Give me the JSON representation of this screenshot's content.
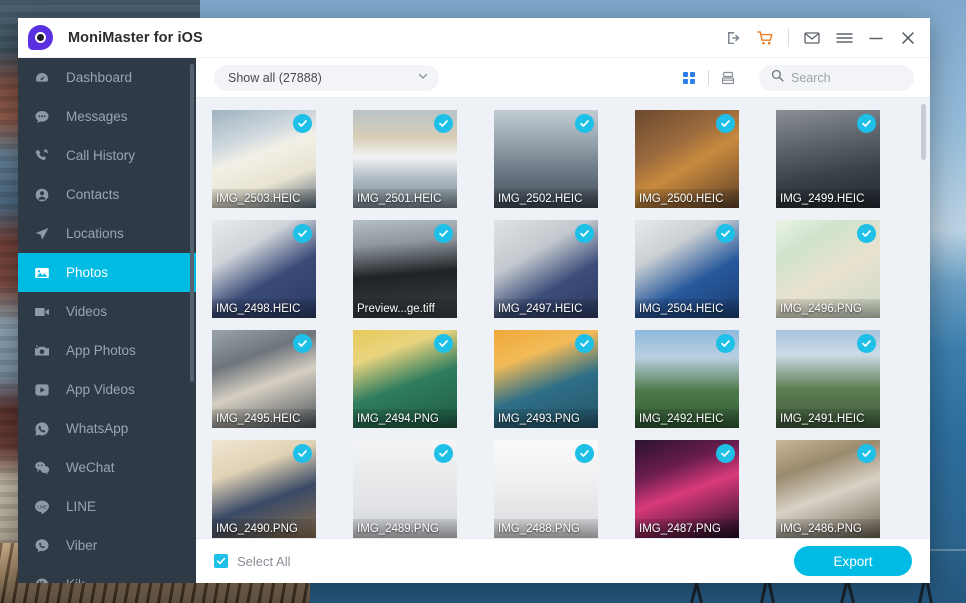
{
  "window": {
    "app_title": "MoniMaster for iOS",
    "logo_color": "#5b30e0",
    "accent_color": "#00bce4",
    "titlebar_icons": [
      {
        "name": "export-device-icon",
        "label": "Export"
      },
      {
        "name": "shopping-cart-icon",
        "label": "Store"
      },
      {
        "name": "mail-icon",
        "label": "Mail"
      },
      {
        "name": "menu-icon",
        "label": "Menu"
      },
      {
        "name": "minimize-icon",
        "label": "Minimize"
      },
      {
        "name": "close-icon",
        "label": "Close"
      }
    ]
  },
  "sidebar": {
    "items": [
      {
        "label": "Dashboard",
        "icon": "dashboard-icon",
        "active": false
      },
      {
        "label": "Messages",
        "icon": "messages-icon",
        "active": false
      },
      {
        "label": "Call History",
        "icon": "call-history-icon",
        "active": false
      },
      {
        "label": "Contacts",
        "icon": "contacts-icon",
        "active": false
      },
      {
        "label": "Locations",
        "icon": "locations-icon",
        "active": false
      },
      {
        "label": "Photos",
        "icon": "photos-icon",
        "active": true
      },
      {
        "label": "Videos",
        "icon": "videos-icon",
        "active": false
      },
      {
        "label": "App Photos",
        "icon": "app-photos-icon",
        "active": false
      },
      {
        "label": "App Videos",
        "icon": "app-videos-icon",
        "active": false
      },
      {
        "label": "WhatsApp",
        "icon": "whatsapp-icon",
        "active": false
      },
      {
        "label": "WeChat",
        "icon": "wechat-icon",
        "active": false
      },
      {
        "label": "LINE",
        "icon": "line-icon",
        "active": false
      },
      {
        "label": "Viber",
        "icon": "viber-icon",
        "active": false
      },
      {
        "label": "Kik",
        "icon": "kik-icon",
        "active": false
      }
    ]
  },
  "toolbar": {
    "filter_label": "Show all (27888)",
    "grid_view_label": "Grid view",
    "list_view_label": "List view",
    "search_placeholder": "Search",
    "search_value": ""
  },
  "grid": {
    "items": [
      {
        "filename": "IMG_2503.HEIC",
        "selected": true
      },
      {
        "filename": "IMG_2501.HEIC",
        "selected": true
      },
      {
        "filename": "IMG_2502.HEIC",
        "selected": true
      },
      {
        "filename": "IMG_2500.HEIC",
        "selected": true
      },
      {
        "filename": "IMG_2499.HEIC",
        "selected": true
      },
      {
        "filename": "IMG_2498.HEIC",
        "selected": true
      },
      {
        "filename": "Preview...ge.tiff",
        "selected": true
      },
      {
        "filename": "IMG_2497.HEIC",
        "selected": true
      },
      {
        "filename": "IMG_2504.HEIC",
        "selected": true
      },
      {
        "filename": "IMG_2496.PNG",
        "selected": true
      },
      {
        "filename": "IMG_2495.HEIC",
        "selected": true
      },
      {
        "filename": "IMG_2494.PNG",
        "selected": true
      },
      {
        "filename": "IMG_2493.PNG",
        "selected": true
      },
      {
        "filename": "IMG_2492.HEIC",
        "selected": true
      },
      {
        "filename": "IMG_2491.HEIC",
        "selected": true
      },
      {
        "filename": "IMG_2490.PNG",
        "selected": true
      },
      {
        "filename": "IMG_2489.PNG",
        "selected": true
      },
      {
        "filename": "IMG_2488.PNG",
        "selected": true
      },
      {
        "filename": "IMG_2487.PNG",
        "selected": true
      },
      {
        "filename": "IMG_2486.PNG",
        "selected": true
      }
    ]
  },
  "footer": {
    "select_all_label": "Select All",
    "select_all_checked": true,
    "export_label": "Export"
  }
}
